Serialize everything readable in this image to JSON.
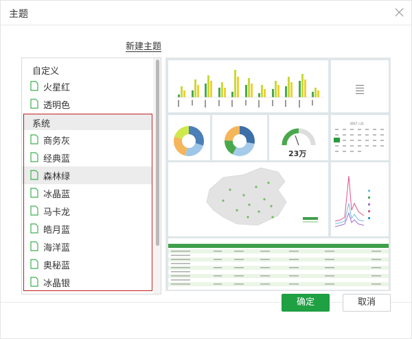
{
  "dialog": {
    "title": "主题",
    "new_theme": "新建主题"
  },
  "list": {
    "custom_label": "自定义",
    "custom_items": [
      "火星红",
      "透明色"
    ],
    "system_label": "系统",
    "system_items": [
      "商务灰",
      "经典蓝",
      "森林绿",
      "冰晶蓝",
      "马卡龙",
      "皓月蓝",
      "海洋蓝",
      "奥秘蓝",
      "冰晶银"
    ],
    "selected": "森林绿"
  },
  "buttons": {
    "ok": "确定",
    "cancel": "取消"
  },
  "preview": {
    "gauge_value": "23万",
    "calendar_month": "2017 八月"
  },
  "colors": {
    "accent": "#1fa043",
    "selection_border": "#c21e1e",
    "selected_bg": "#ececec"
  }
}
